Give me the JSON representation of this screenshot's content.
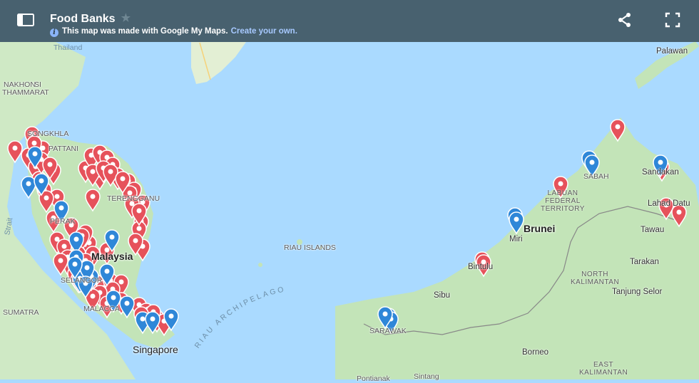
{
  "header": {
    "title": "Food Banks",
    "made_with_text": "This map was made with Google My Maps.",
    "create_link": "Create your own.",
    "icons": [
      "sidebar-toggle-icon",
      "star-icon",
      "info-icon",
      "share-icon",
      "fullscreen-icon"
    ]
  },
  "colors": {
    "header_bg": "#48616f",
    "water": "#aadaff",
    "land": "#c9e7c0",
    "pin_red": "#e6525b",
    "pin_blue": "#2f87d8"
  },
  "labels": {
    "thailand": "Thailand",
    "nakhon": "NAKHON",
    "si": "SI",
    "thammarat": "THAMMARAT",
    "songkhla": "SONGKHLA",
    "pattani": "PATTANI",
    "perak": "PERAK",
    "terengganu": "TERENGGANU",
    "malaysia": "Malaysia",
    "selangor": "SELANGOR",
    "malacca": "MALACCA",
    "sumatra": "SUMATRA",
    "singapore": "Singapore",
    "riau_islands": "RIAU ISLANDS",
    "riau_archipelago": "RIAU ARCHIPELAGO",
    "sarawak": "SARAWAK",
    "sibu": "Sibu",
    "bintulu": "Bintulu",
    "miri": "Miri",
    "brunei": "Brunei",
    "labuan_1": "LABUAN",
    "labuan_2": "FEDERAL",
    "labuan_3": "TERRITORY",
    "sabah": "SABAH",
    "sandakan": "Sandakan",
    "lahad_datu": "Lahad Datu",
    "tawau": "Tawau",
    "palawan": "Palawan",
    "tarakan": "Tarakan",
    "north_kal_1": "NORTH",
    "north_kal_2": "KALIMANTAN",
    "tanjung_selor": "Tanjung Selor",
    "borneo": "Borneo",
    "east_kal_1": "EAST",
    "east_kal_2": "KALIMANTAN",
    "pontianak": "Pontianak",
    "sintang": "Sintang",
    "strait": "Strait"
  },
  "markers": {
    "red_count": 75,
    "blue_count": 27
  }
}
